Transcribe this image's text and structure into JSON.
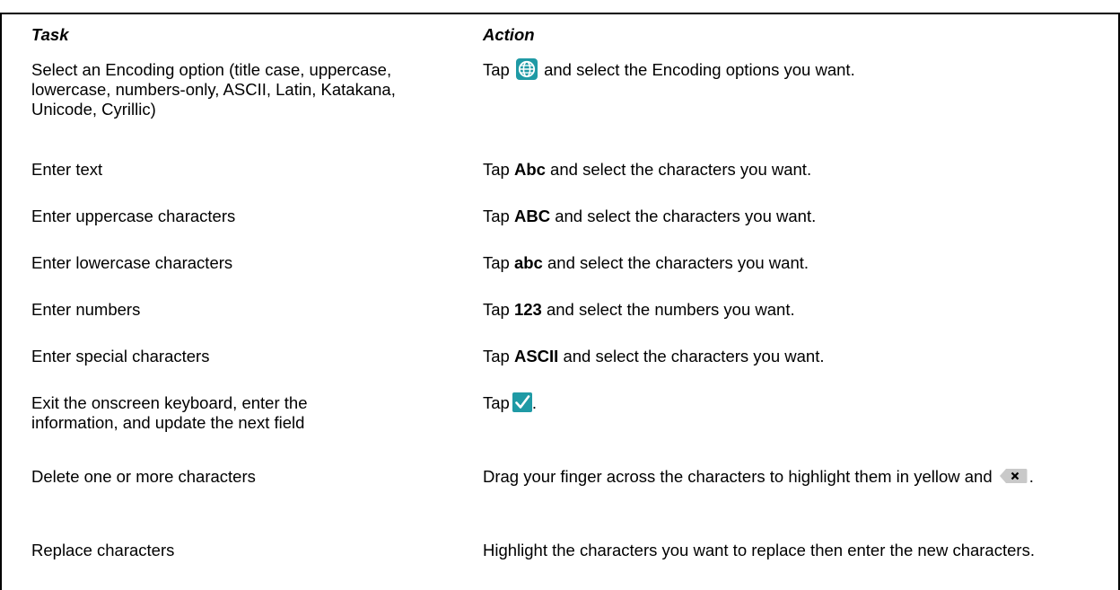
{
  "table": {
    "header": {
      "task": "Task",
      "action": "Action"
    },
    "rows": [
      {
        "task": "Select an Encoding option (title case, uppercase, lowercase, numbers-only, ASCII, Latin, Katakana, Unicode, Cyrillic)",
        "action_pre": "Tap",
        "action_icon": "globe-icon",
        "action_post": " and select the Encoding options you want."
      },
      {
        "task": "Enter text",
        "action_pre": "Tap ",
        "action_bold": "Abc",
        "action_post": " and select the characters you want."
      },
      {
        "task": "Enter uppercase characters",
        "action_pre": "Tap ",
        "action_bold": "ABC",
        "action_post": " and select the characters you want."
      },
      {
        "task": "Enter lowercase characters",
        "action_pre": "Tap ",
        "action_bold": "abc",
        "action_post": " and select the characters you want."
      },
      {
        "task": "Enter numbers",
        "action_pre": "Tap ",
        "action_bold": "123",
        "action_post": " and select the numbers you want."
      },
      {
        "task": "Enter special characters",
        "action_pre": "Tap ",
        "action_bold": "ASCII",
        "action_post": " and select the characters you want."
      },
      {
        "task": "Exit the onscreen keyboard, enter the information, and update the next field",
        "action_pre": "Tap",
        "action_icon": "check-icon",
        "action_post": "."
      },
      {
        "task": "Delete one or more characters",
        "action_pre": "Drag your finger across the characters to highlight them in yellow and",
        "action_icon": "backspace-icon",
        "action_post": "."
      },
      {
        "task": "Replace characters",
        "action_pre": "Highlight the characters you want to replace then enter the new characters."
      }
    ]
  },
  "colors": {
    "icon_teal": "#1f9aa5",
    "key_gray": "#c9c9c9"
  }
}
